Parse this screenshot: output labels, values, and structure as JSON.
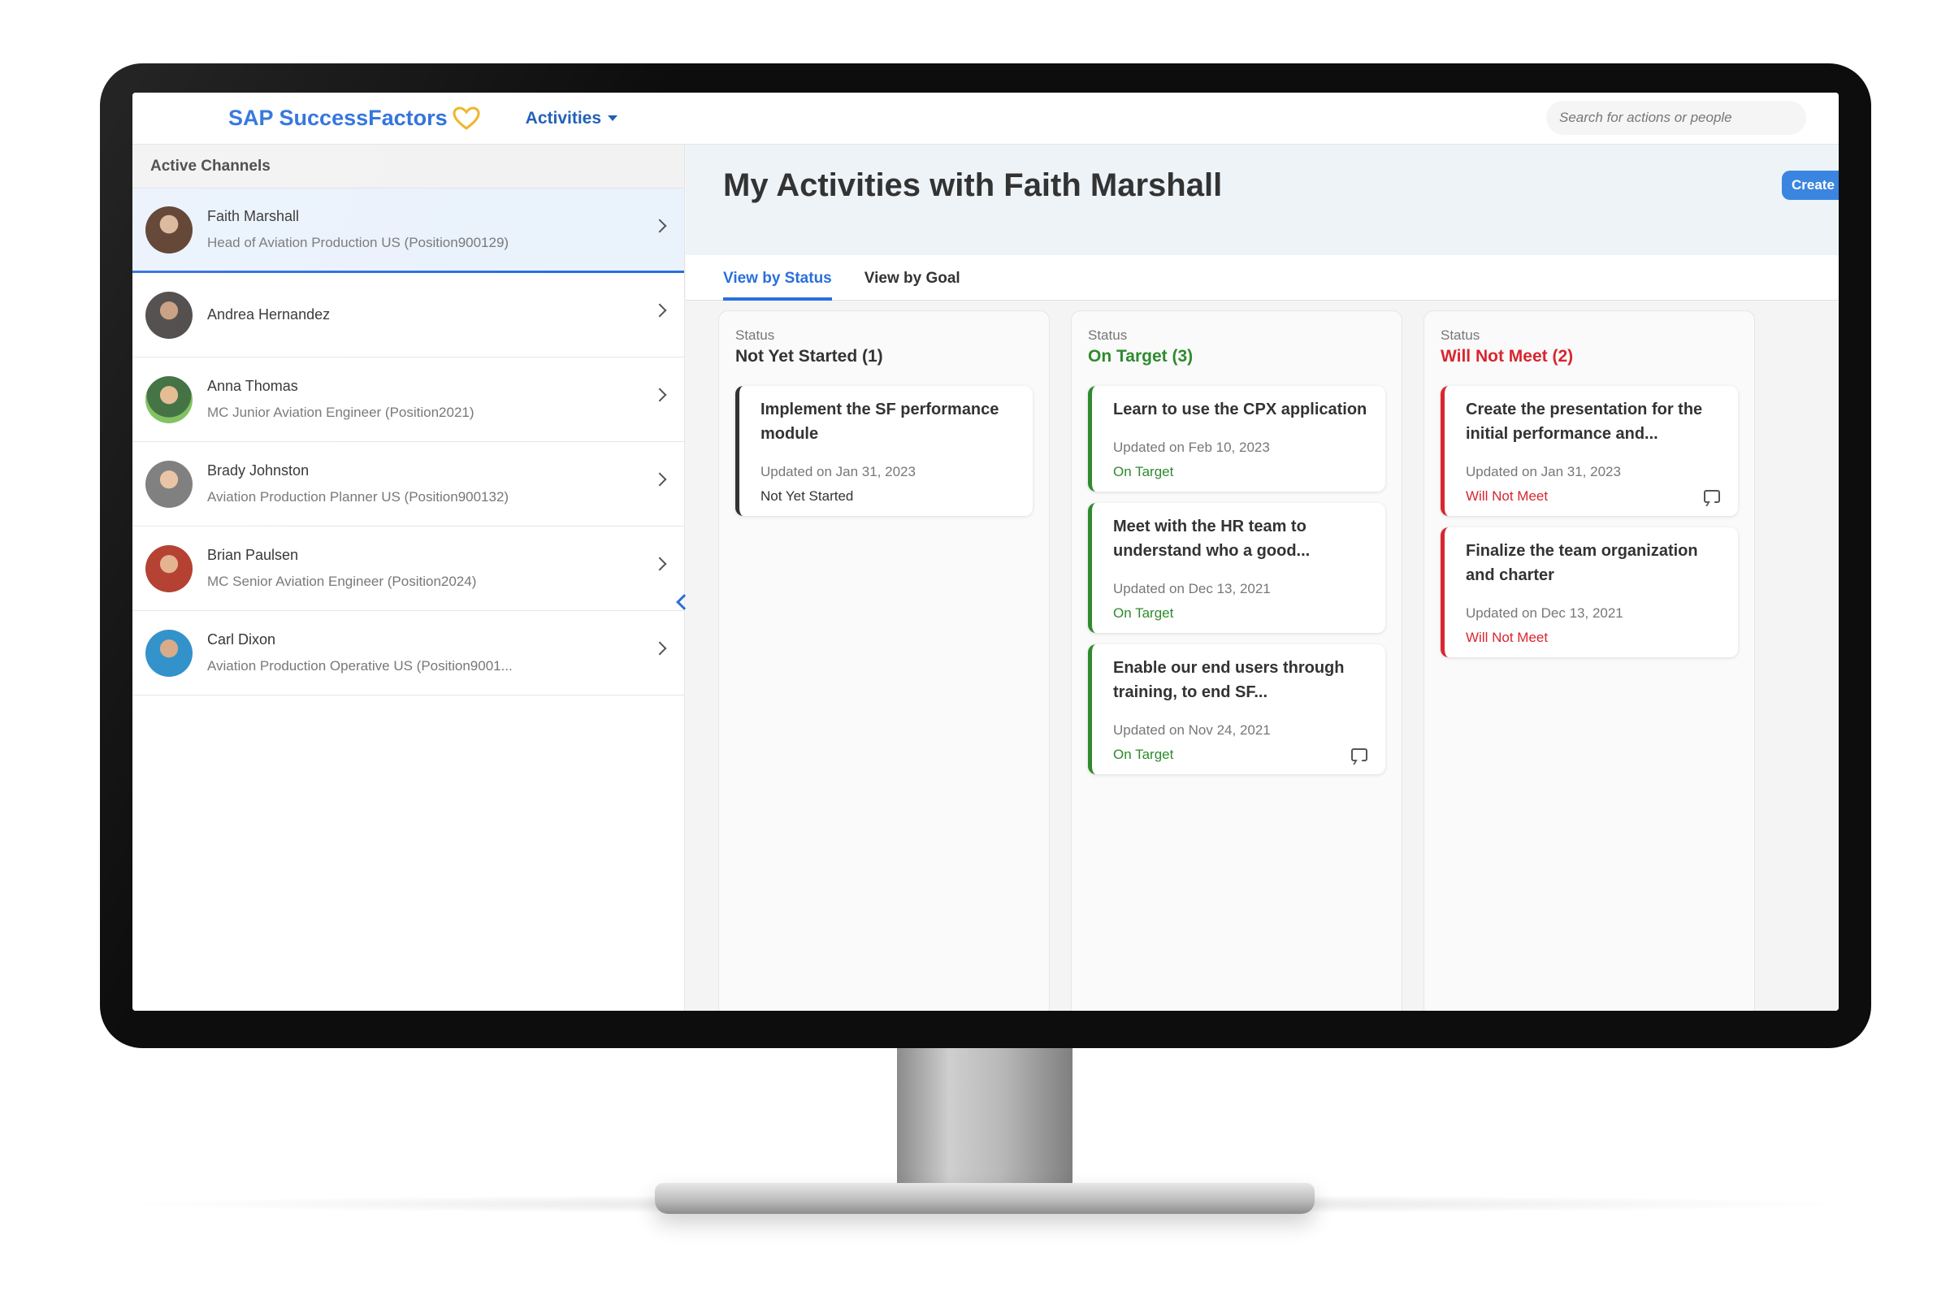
{
  "shell": {
    "logo_text": "SAP SuccessFactors",
    "menu_label": "Activities",
    "search_placeholder": "Search for actions or people"
  },
  "sidebar": {
    "heading": "Active Channels",
    "channels": [
      {
        "name": "Faith Marshall",
        "subtitle": "Head of Aviation Production US (Position900129)"
      },
      {
        "name": "Andrea Hernandez",
        "subtitle": ""
      },
      {
        "name": "Anna Thomas",
        "subtitle": "MC Junior Aviation Engineer (Position2021)"
      },
      {
        "name": "Brady Johnston",
        "subtitle": "Aviation Production Planner US (Position900132)"
      },
      {
        "name": "Brian Paulsen",
        "subtitle": "MC Senior Aviation Engineer (Position2024)"
      },
      {
        "name": "Carl Dixon",
        "subtitle": "Aviation Production Operative US (Position9001..."
      }
    ]
  },
  "main": {
    "title": "My Activities with Faith Marshall",
    "create_label": "Create",
    "tabs": [
      {
        "label": "View by Status"
      },
      {
        "label": "View by Goal"
      }
    ],
    "columns": [
      {
        "caption": "Status",
        "title": "Not Yet Started (1)",
        "color": "#333333",
        "cards": [
          {
            "title": "Implement the SF performance module",
            "date": "Updated on Jan 31, 2023",
            "status": "Not Yet Started"
          }
        ]
      },
      {
        "caption": "Status",
        "title": "On Target (3)",
        "color": "#2e8b2e",
        "cards": [
          {
            "title": "Learn to use the CPX application",
            "date": "Updated on Feb 10, 2023",
            "status": "On Target"
          },
          {
            "title": "Meet with the HR team to understand who a good...",
            "date": "Updated on Dec 13, 2021",
            "status": "On Target"
          },
          {
            "title": "Enable our end users through training, to end SF...",
            "date": "Updated on Nov 24, 2021",
            "status": "On Target"
          }
        ]
      },
      {
        "caption": "Status",
        "title": "Will Not Meet (2)",
        "color": "#d9262f",
        "cards": [
          {
            "title": "Create the presentation for the initial performance and...",
            "date": "Updated on Jan 31, 2023",
            "status": "Will Not Meet"
          },
          {
            "title": "Finalize the team organization and charter",
            "date": "Updated on Dec 13, 2021",
            "status": "Will Not Meet"
          }
        ]
      }
    ]
  },
  "colors": {
    "brand": "#2a6fdb",
    "on_target": "#2e8b2e",
    "will_not_meet": "#d9262f",
    "not_started": "#333333"
  }
}
